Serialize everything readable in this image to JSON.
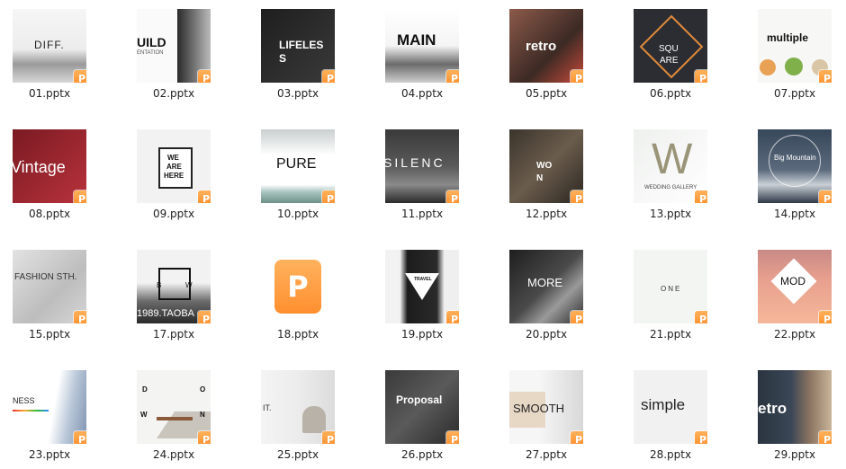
{
  "colors": {
    "badge": "#ff9a3c",
    "label_text": "#222222",
    "background": "#ffffff"
  },
  "badge_icon": "wps-presentation-icon",
  "files": [
    {
      "label": "01.pptx",
      "thumb_title": "DIFF."
    },
    {
      "label": "02.pptx",
      "thumb_title": "UILD",
      "thumb_sub": "ENTATION"
    },
    {
      "label": "03.pptx",
      "thumb_title": "LIFELES",
      "thumb_title2": "S"
    },
    {
      "label": "04.pptx",
      "thumb_title": "MAIN"
    },
    {
      "label": "05.pptx",
      "thumb_title": "retro"
    },
    {
      "label": "06.pptx",
      "thumb_title": "SQU",
      "thumb_title2": "ARE"
    },
    {
      "label": "07.pptx",
      "thumb_title": "multiple"
    },
    {
      "label": "08.pptx",
      "thumb_title": "Vintage"
    },
    {
      "label": "09.pptx",
      "thumb_title": "WE",
      "thumb_title2": "ARE",
      "thumb_title3": "HERE"
    },
    {
      "label": "10.pptx",
      "thumb_title": "PURE"
    },
    {
      "label": "11.pptx",
      "thumb_title": "SILENC"
    },
    {
      "label": "12.pptx",
      "thumb_title": "WO",
      "thumb_title2": "N"
    },
    {
      "label": "13.pptx",
      "thumb_title": "W",
      "thumb_sub": "WEDDING GALLERY"
    },
    {
      "label": "14.pptx",
      "thumb_title": "Big Mountain"
    },
    {
      "label": "15.pptx",
      "thumb_title": "FASHION STH."
    },
    {
      "label": "17.pptx",
      "thumb_title": "B",
      "thumb_title2": "W",
      "thumb_sub": "1989.TAOBA"
    },
    {
      "label": "18.pptx",
      "generic": true,
      "generic_icon": "wps-presentation-icon"
    },
    {
      "label": "19.pptx",
      "thumb_title": "TRAVEL"
    },
    {
      "label": "20.pptx",
      "thumb_title": "MORE"
    },
    {
      "label": "21.pptx",
      "thumb_title": "ONE"
    },
    {
      "label": "22.pptx",
      "thumb_title": "MOD"
    },
    {
      "label": "23.pptx",
      "thumb_title": "NESS"
    },
    {
      "label": "24.pptx",
      "thumb_title": "D",
      "thumb_title2": "O",
      "thumb_title3": "W",
      "thumb_title4": "N"
    },
    {
      "label": "25.pptx",
      "thumb_title": "IT."
    },
    {
      "label": "26.pptx",
      "thumb_title": "Proposal"
    },
    {
      "label": "27.pptx",
      "thumb_title": "SMOOTH"
    },
    {
      "label": "28.pptx",
      "thumb_title": "simple"
    },
    {
      "label": "29.pptx",
      "thumb_title": "etro"
    }
  ]
}
